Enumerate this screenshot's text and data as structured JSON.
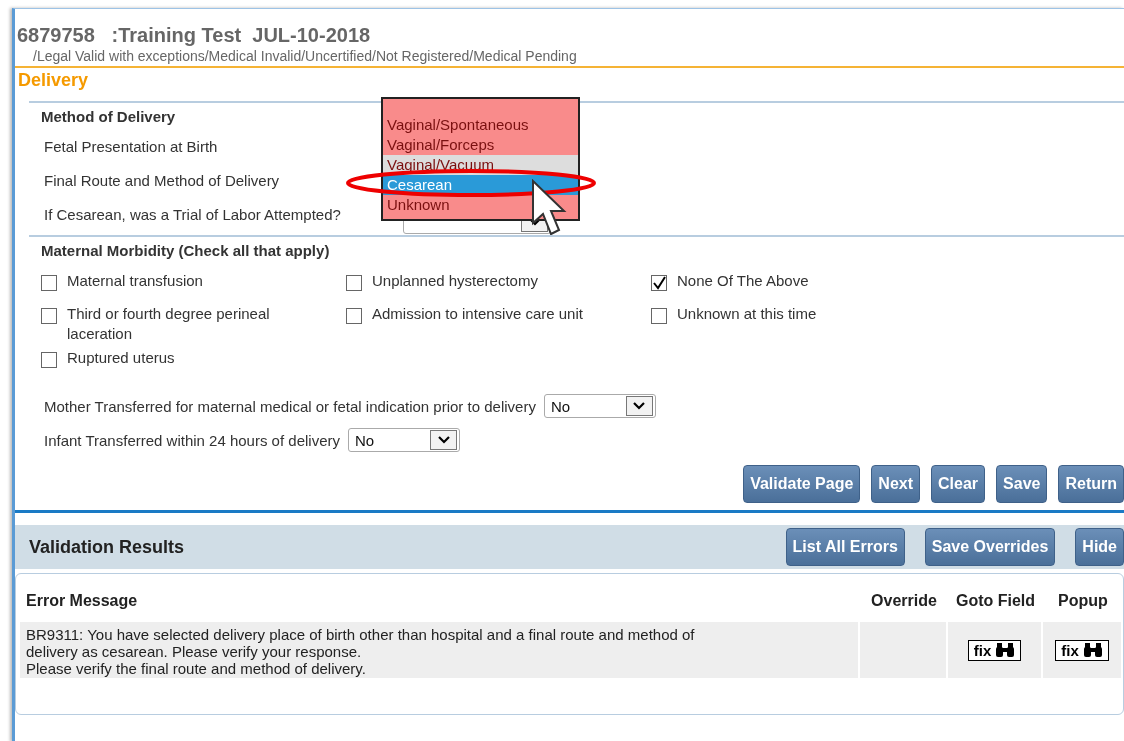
{
  "header": {
    "title": "6879758   :Training Test  JUL-10-2018",
    "status": "/Legal Valid with exceptions/Medical Invalid/Uncertified/Not Registered/Medical Pending"
  },
  "page_title": "Delivery",
  "method_section": {
    "title": "Method of Delivery",
    "fields": [
      {
        "label": "Fetal Presentation at Birth"
      },
      {
        "label": "Final Route and Method of Delivery"
      },
      {
        "label": "If Cesarean, was a Trial of Labor Attempted?"
      }
    ]
  },
  "dropdown_list": {
    "options": [
      {
        "label": "Vaginal/Spontaneous",
        "selected": false,
        "disabled": false
      },
      {
        "label": "Vaginal/Forceps",
        "selected": false,
        "disabled": false
      },
      {
        "label": "Vaginal/Vacuum",
        "selected": false,
        "disabled": true
      },
      {
        "label": "Cesarean",
        "selected": true,
        "disabled": false
      },
      {
        "label": "Unknown",
        "selected": false,
        "disabled": false
      }
    ]
  },
  "morbidity_section": {
    "title": "Maternal Morbidity (Check all that apply)",
    "columns": [
      [
        {
          "label": "Maternal transfusion",
          "checked": false
        },
        {
          "label": "Third or fourth degree perineal laceration",
          "checked": false
        },
        {
          "label": "Ruptured uterus",
          "checked": false
        }
      ],
      [
        {
          "label": "Unplanned hysterectomy",
          "checked": false
        },
        {
          "label": "Admission to intensive care unit",
          "checked": false
        }
      ],
      [
        {
          "label": "None Of The Above",
          "checked": true
        },
        {
          "label": "Unknown at this time",
          "checked": false
        }
      ]
    ]
  },
  "transfers": [
    {
      "label": "Mother Transferred for maternal medical or fetal indication prior to delivery",
      "value": "No"
    },
    {
      "label": "Infant Transferred within 24 hours of delivery",
      "value": "No"
    }
  ],
  "page_buttons": [
    "Validate Page",
    "Next",
    "Clear",
    "Save",
    "Return"
  ],
  "validation": {
    "title": "Validation Results",
    "buttons": [
      "List All Errors",
      "Save Overrides",
      "Hide"
    ],
    "columns": [
      "Error Message",
      "Override",
      "Goto Field",
      "Popup"
    ],
    "rows": [
      {
        "lines": [
          "BR9311:  You have selected delivery place of birth other than hospital and a final route and method of",
          "delivery as cesarean. Please verify your response.",
          "Please verify the final route and method of delivery."
        ],
        "goto": "fix",
        "popup": "fix"
      }
    ]
  }
}
